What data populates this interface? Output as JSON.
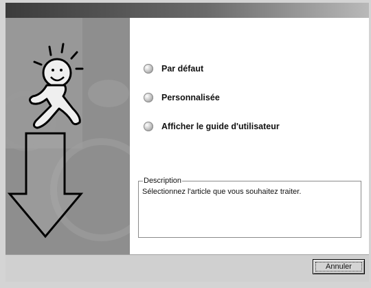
{
  "options": [
    {
      "label": "Par défaut",
      "icon": "radio-bullet-icon"
    },
    {
      "label": "Personnalisée",
      "icon": "radio-bullet-icon"
    },
    {
      "label": "Afficher le guide d'utilisateur",
      "icon": "radio-bullet-icon"
    }
  ],
  "description": {
    "legend": "Description",
    "text": "Sélectionnez l'article que vous souhaitez traiter."
  },
  "footer": {
    "cancel_label": "Annuler"
  },
  "colors": {
    "panel_bg": "#8f8f8f",
    "content_bg": "#ffffff",
    "chrome": "#d4d4d4"
  }
}
